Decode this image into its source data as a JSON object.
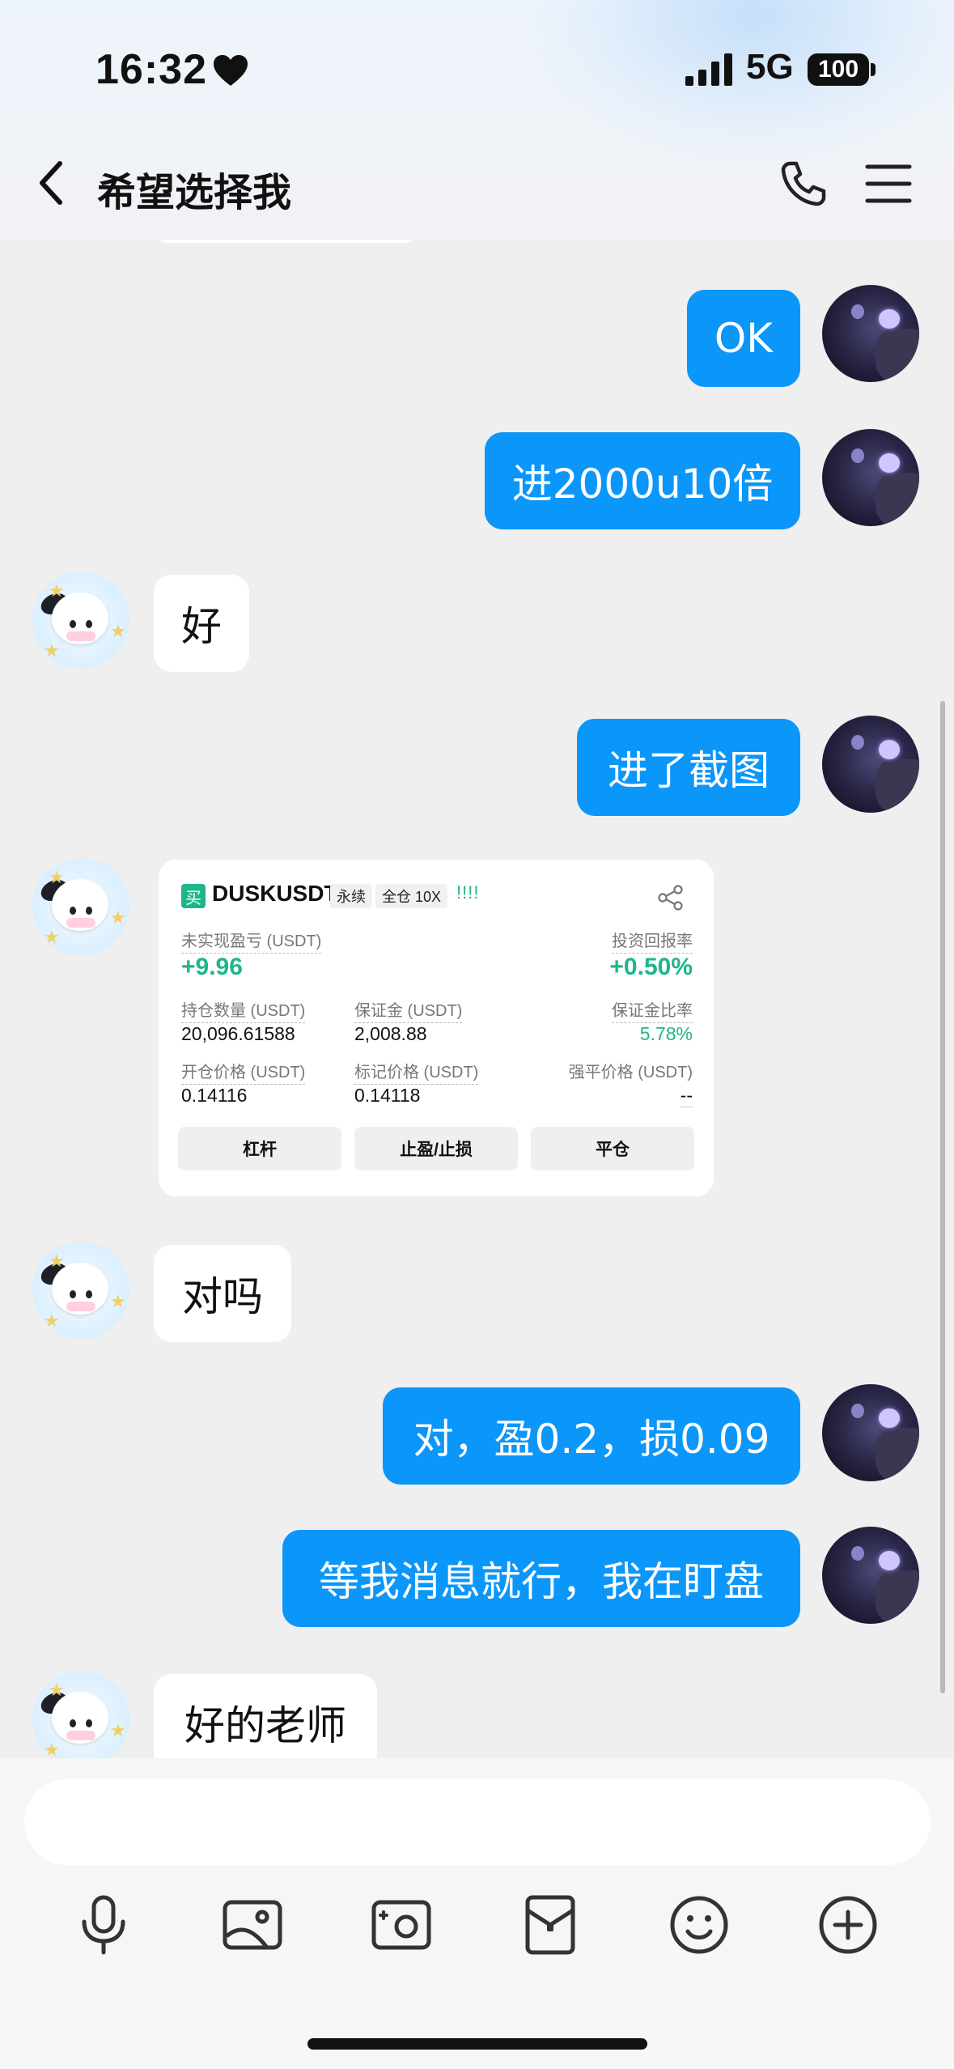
{
  "status_bar": {
    "time": "16:32",
    "network": "5G",
    "battery": "100"
  },
  "nav": {
    "title": "希望选择我"
  },
  "messages": [
    {
      "side": "out",
      "text": "OK"
    },
    {
      "side": "out",
      "text": "进2000u10倍"
    },
    {
      "side": "in",
      "text": "好"
    },
    {
      "side": "out",
      "text": "进了截图"
    },
    {
      "side": "in",
      "type": "image-card"
    },
    {
      "side": "in",
      "text": "对吗"
    },
    {
      "side": "out",
      "text": "对，盈0.2，损0.09"
    },
    {
      "side": "out",
      "text": "等我消息就行，我在盯盘"
    },
    {
      "side": "in",
      "text": "好的老师"
    }
  ],
  "trade_card": {
    "buy_tag": "买",
    "symbol": "DUSKUSDT",
    "chip_perpetual": "永续",
    "chip_margin": "全仓 10X",
    "signal_bars": "!!!!",
    "unrealized_pnl_label": "未实现盈亏 (USDT)",
    "unrealized_pnl_value": "+9.96",
    "roi_label": "投资回报率",
    "roi_value": "+0.50%",
    "position_size_label": "持仓数量 (USDT)",
    "position_size_value": "20,096.61588",
    "margin_label": "保证金 (USDT)",
    "margin_value": "2,008.88",
    "margin_ratio_label": "保证金比率",
    "margin_ratio_value": "5.78%",
    "entry_price_label": "开仓价格 (USDT)",
    "entry_price_value": "0.14116",
    "mark_price_label": "标记价格 (USDT)",
    "mark_price_value": "0.14118",
    "liq_price_label": "强平价格 (USDT)",
    "liq_price_value": "--",
    "btn_leverage": "杠杆",
    "btn_tpsl": "止盈/止损",
    "btn_close": "平仓",
    "accent_color": "#1fb58a"
  },
  "colors": {
    "outgoing_bubble": "#0b96fa",
    "incoming_bubble": "#ffffff",
    "chat_background": "#efefef"
  },
  "toolbar_icons": [
    "microphone-icon",
    "photo-icon",
    "camera-icon",
    "red-packet-icon",
    "emoji-icon",
    "plus-icon"
  ]
}
